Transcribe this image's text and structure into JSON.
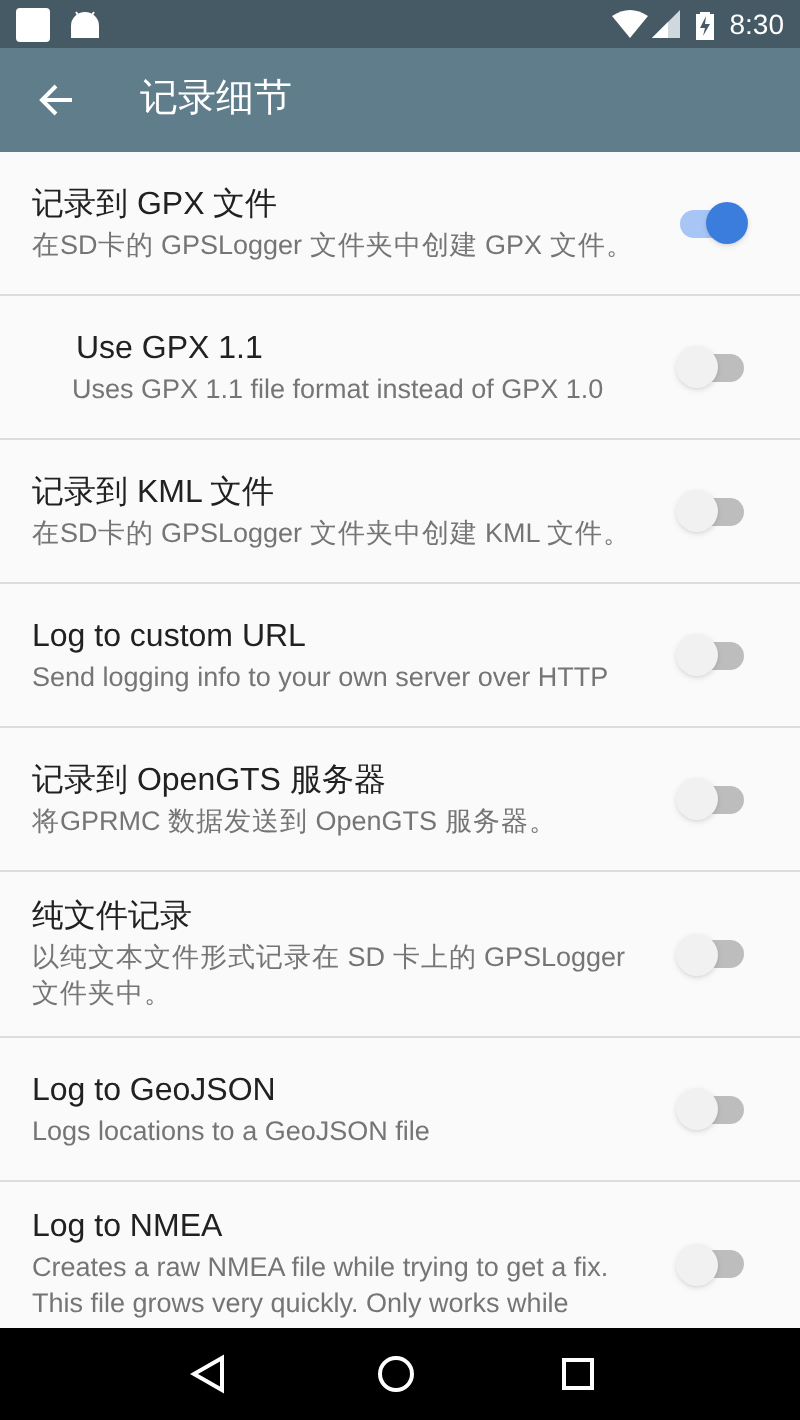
{
  "status_bar": {
    "time": "8:30"
  },
  "toolbar": {
    "title": "记录细节"
  },
  "settings": [
    {
      "title": "记录到 GPX 文件",
      "summary": "在SD卡的 GPSLogger 文件夹中创建 GPX 文件。",
      "on": true,
      "children": [
        {
          "title": "Use GPX 1.1",
          "summary": "Uses GPX 1.1 file format instead of GPX 1.0",
          "on": false
        }
      ]
    },
    {
      "title": "记录到 KML 文件",
      "summary": "在SD卡的 GPSLogger 文件夹中创建 KML 文件。",
      "on": false
    },
    {
      "title": "Log to custom URL",
      "summary": "Send logging info to your own server over HTTP",
      "on": false
    },
    {
      "title": "记录到 OpenGTS 服务器",
      "summary": "将GPRMC 数据发送到 OpenGTS 服务器。",
      "on": false
    },
    {
      "title": "纯文件记录",
      "summary": "以纯文本文件形式记录在 SD 卡上的 GPSLogger 文件夹中。",
      "on": false
    },
    {
      "title": "Log to GeoJSON",
      "summary": "Logs locations to a GeoJSON file",
      "on": false
    },
    {
      "title": "Log to NMEA",
      "summary": "Creates a raw NMEA file while trying to get a fix. This file grows very quickly. Only works while",
      "on": false
    }
  ]
}
